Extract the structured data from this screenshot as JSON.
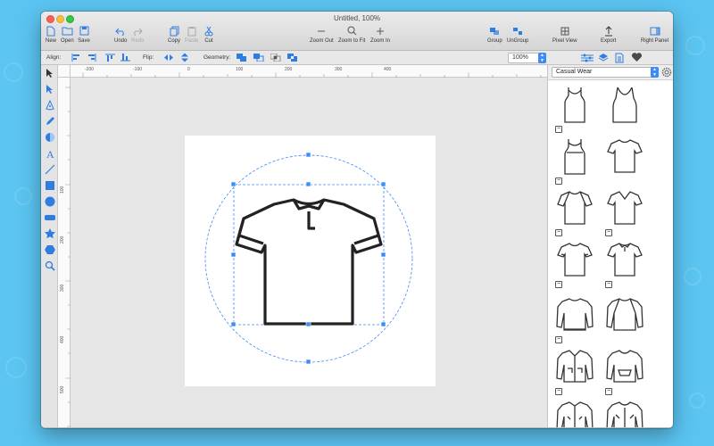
{
  "window": {
    "title": "Untitled, 100%"
  },
  "toolbar": {
    "new_label": "New",
    "open_label": "Open",
    "save_label": "Save",
    "undo_label": "Undo",
    "redo_label": "Redo",
    "copy_label": "Copy",
    "paste_label": "Paste",
    "cut_label": "Cut",
    "zoom_out_label": "Zoom Out",
    "zoom_fit_label": "Zoom to Fit",
    "zoom_in_label": "Zoom In",
    "group_label": "Group",
    "ungroup_label": "UnGroup",
    "pixel_view_label": "Pixel View",
    "export_label": "Export",
    "right_panel_label": "Right Panel"
  },
  "secondary_toolbar": {
    "align_label": "Align:",
    "flip_label": "Flip:",
    "geometry_label": "Geometry:",
    "zoom_value": "100%"
  },
  "rulers": {
    "top": [
      "-200",
      "-100",
      "0",
      "100",
      "200",
      "300",
      "400"
    ],
    "left": [
      "100",
      "200",
      "300",
      "400",
      "500"
    ]
  },
  "shape_panel": {
    "category": "Casual Wear",
    "items": [
      "tank-top",
      "tank-top-sleeveless",
      "racerback-tank",
      "t-shirt-crew",
      "raglan-tee",
      "v-neck-tee",
      "crew-neck-tee",
      "polo-shirt",
      "sweatshirt",
      "raglan-sweatshirt",
      "hooded-jacket",
      "hoodie",
      "zip-jacket",
      "zip-hoodie"
    ]
  },
  "colors": {
    "accent": "#3d8bf7",
    "desktop": "#5bc4f1",
    "selection": "#3d8bf7"
  }
}
